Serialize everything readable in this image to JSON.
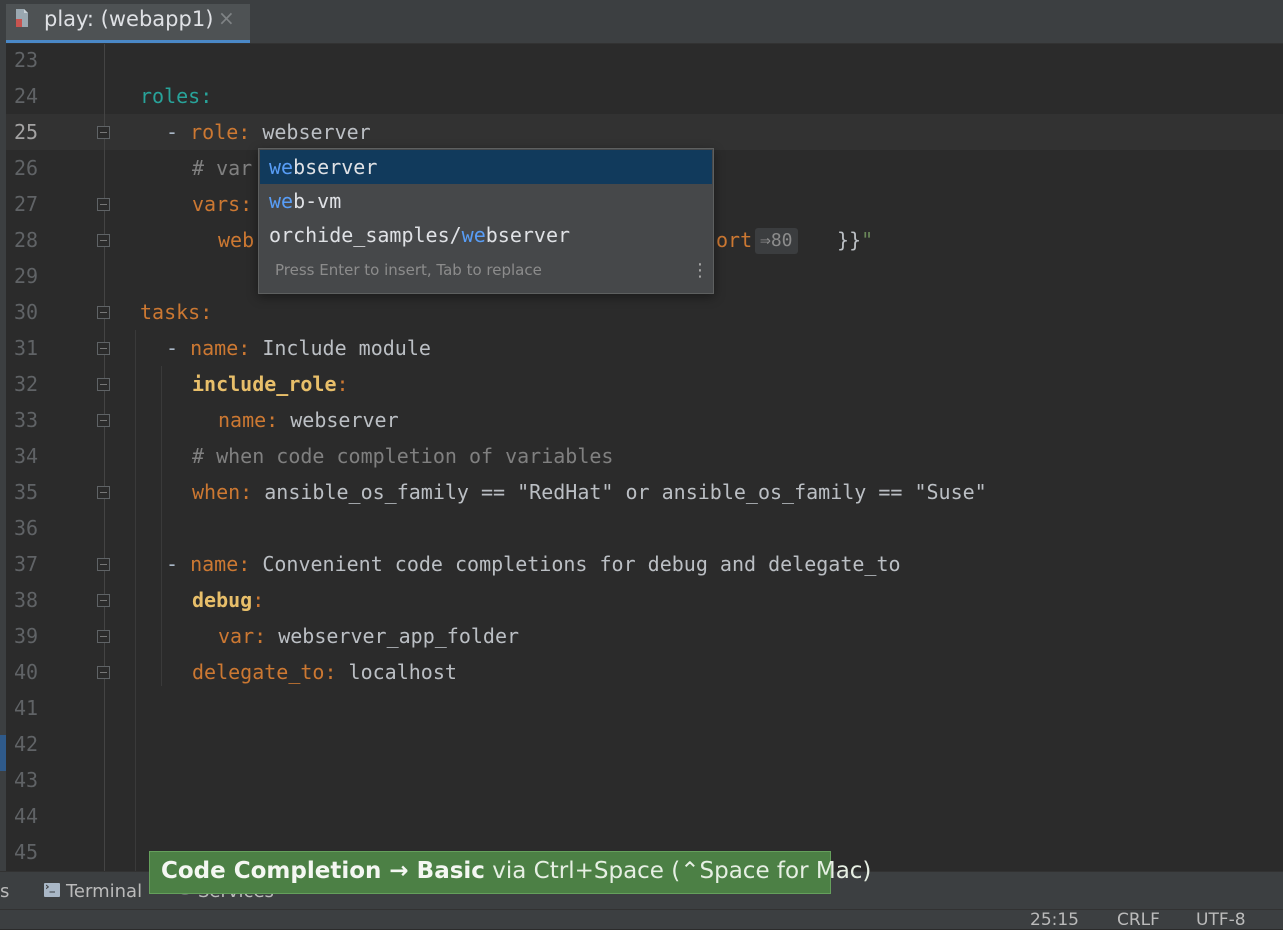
{
  "tab": {
    "title": "play: (webapp1)",
    "close": "×",
    "icon": "yaml-play-file-icon"
  },
  "editor": {
    "line_numbers": [
      "23",
      "24",
      "25",
      "26",
      "27",
      "28",
      "29",
      "30",
      "31",
      "32",
      "33",
      "34",
      "35",
      "36",
      "37",
      "38",
      "39",
      "40",
      "41",
      "42",
      "43",
      "44",
      "45"
    ],
    "current_line": "25",
    "lines": {
      "l24": {
        "key": "roles",
        "colon": ":"
      },
      "l25": {
        "dash": "- ",
        "key": "role",
        "colon": ":",
        "value": " webserver"
      },
      "l26": {
        "comment": "# var"
      },
      "l27": {
        "key": "vars",
        "colon": ":"
      },
      "l28a": {
        "text": "web"
      },
      "l28b": {
        "text": "ort",
        "tail": " }}",
        "quote": "\""
      },
      "l30": {
        "key": "tasks",
        "colon": ":"
      },
      "l31": {
        "dash": "- ",
        "key": "name",
        "colon": ":",
        "value": " Include module"
      },
      "l32": {
        "key": "include_role",
        "colon": ":"
      },
      "l33": {
        "key": "name",
        "colon": ":",
        "value": " webserver"
      },
      "l34": {
        "comment": "# when code completion of variables"
      },
      "l35": {
        "key": "when",
        "colon": ":",
        "value": " ansible_os_family == \"RedHat\" or ansible_os_family == \"Suse\""
      },
      "l37": {
        "dash": "- ",
        "key": "name",
        "colon": ":",
        "value": " Convenient code completions for debug and delegate_to"
      },
      "l38": {
        "key": "debug",
        "colon": ":"
      },
      "l39": {
        "key": "var",
        "colon": ":",
        "value": " webserver_app_folder"
      },
      "l40": {
        "key": "delegate_to",
        "colon": ":",
        "value": " localhost"
      }
    },
    "inline_hint": "⇒80"
  },
  "completion": {
    "items": [
      {
        "match": "we",
        "rest": "bserver",
        "prefix": "",
        "selected": true
      },
      {
        "match": "we",
        "rest": "b-vm",
        "prefix": "",
        "selected": false
      },
      {
        "match": "we",
        "rest": "bserver",
        "prefix": "orchide_samples/",
        "selected": false
      }
    ],
    "hint": "Press Enter to insert, Tab to replace",
    "menu_glyph": "⋮"
  },
  "bottom_toolbar": {
    "left_cut": "s",
    "terminal": "Terminal",
    "services": "Services"
  },
  "statusbar": {
    "position": "25:15",
    "line_ending": "CRLF",
    "encoding": "UTF-8"
  },
  "banner": {
    "bold": "Code Completion → Basic",
    "rest": " via Ctrl+Space (⌃Space for Mac)"
  },
  "colors": {
    "accent": "#4a88c7",
    "selection": "#113a5c",
    "banner": "#4c8045"
  }
}
